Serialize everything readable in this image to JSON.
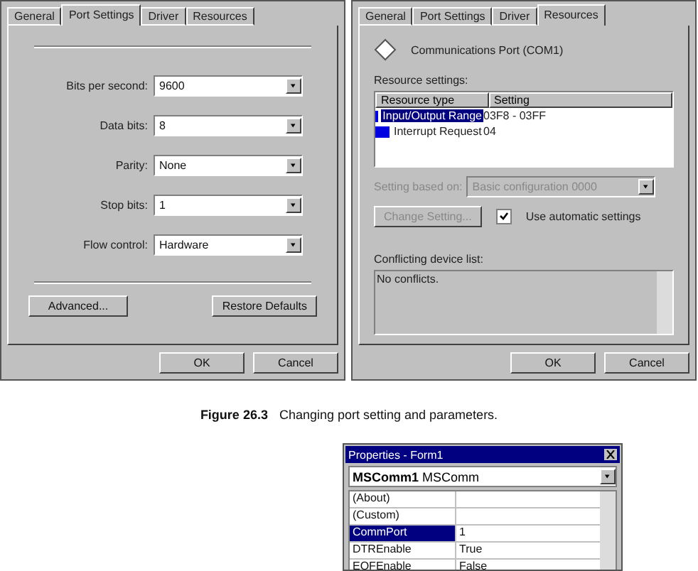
{
  "dialogs": [
    {
      "kind": "port_settings",
      "tabs": [
        {
          "label": "General",
          "selected": false
        },
        {
          "label": "Port Settings",
          "selected": true
        },
        {
          "label": "Driver",
          "selected": false
        },
        {
          "label": "Resources",
          "selected": false
        }
      ],
      "fields": [
        {
          "label": "Bits per second:",
          "value": "9600"
        },
        {
          "label": "Data bits:",
          "value": "8"
        },
        {
          "label": "Parity:",
          "value": "None"
        },
        {
          "label": "Stop bits:",
          "value": "1"
        },
        {
          "label": "Flow control:",
          "value": "Hardware"
        }
      ],
      "buttons": [
        "Advanced...",
        "Restore Defaults"
      ],
      "footer_buttons": [
        "OK",
        "Cancel"
      ]
    },
    {
      "kind": "resources",
      "tabs": [
        {
          "label": "General",
          "selected": false
        },
        {
          "label": "Port Settings",
          "selected": false
        },
        {
          "label": "Driver",
          "selected": false
        },
        {
          "label": "Resources",
          "selected": true
        }
      ],
      "device": "Communications Port (COM1)",
      "list_label": "Resource settings:",
      "columns": [
        "Resource type",
        "Setting"
      ],
      "rows": [
        {
          "type": "Input/Output Range",
          "setting": "03F8 - 03FF",
          "selected": true
        },
        {
          "type": "Interrupt Request",
          "setting": "04",
          "selected": false
        }
      ],
      "based_on": {
        "label": "Setting based on:",
        "value": "Basic configuration 0000",
        "disabled": true
      },
      "change_button": {
        "label": "Change Setting...",
        "disabled": true
      },
      "auto": {
        "label": "Use automatic settings",
        "checked": true
      },
      "conflict_label": "Conflicting device list:",
      "conflicts": "No conflicts.",
      "footer_buttons": [
        "OK",
        "Cancel"
      ]
    }
  ],
  "caption": {
    "number": "Figure 26.3",
    "text": "Changing port setting and parameters."
  },
  "properties": {
    "title": "Properties - Form1",
    "object": "MSComm1",
    "object_type": "MSComm",
    "rows": [
      {
        "name": "(About)",
        "selected": false
      },
      {
        "name": "(Custom)",
        "selected": false
      },
      {
        "name": "CommPort",
        "value": "1",
        "selected": true
      },
      {
        "name": "DTREnable",
        "value": "True",
        "selected": false
      },
      {
        "name": "EOFEnable",
        "value": "False",
        "selected": false
      }
    ]
  }
}
